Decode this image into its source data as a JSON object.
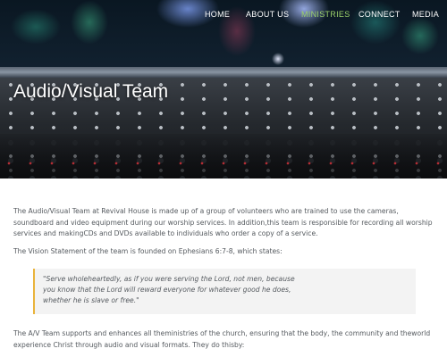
{
  "nav": {
    "items": [
      "HOME",
      "ABOUT US",
      "MINISTRIES",
      "CONNECT",
      "MEDIA"
    ],
    "active": "MINISTRIES",
    "active_color": "#9ad06a"
  },
  "hero": {
    "title": "Audio/Visual Team"
  },
  "content": {
    "paragraph1": "The Audio/Visual Team at Revival House is made up of a group of volunteers who are trained to use the cameras, soundboard and video equipment during our worship services. In addition,this team is responsible for recording all worship services and makingCDs and DVDs available to individuals who order a copy of a service.",
    "paragraph2": "The Vision Statement of the team is founded on Ephesians 6:7-8, which states:",
    "quote_lines": [
      "\"Serve wholeheartedly, as if you were serving the Lord, not men, because",
      "you know that the Lord will reward everyone for whatever good he does,",
      "whether he is slave or free.\""
    ],
    "paragraph3": "The A/V Team supports and enhances all theministries of the church, ensuring that the body, the community and theworld experience Christ through audio and visual formats. They do thisby:"
  },
  "colors": {
    "quote_border": "#e9b33a",
    "quote_background": "#f3f3f3",
    "body_text": "#555a5f"
  }
}
